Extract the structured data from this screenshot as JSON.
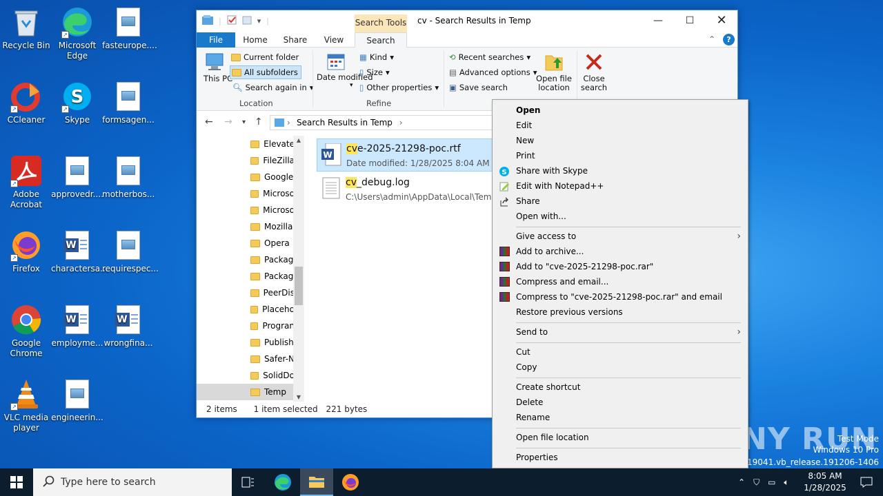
{
  "desktop": {
    "icons": [
      {
        "label": "Recycle Bin",
        "icon": "recycle-bin-icon"
      },
      {
        "label": "CCleaner",
        "icon": "ccleaner-icon"
      },
      {
        "label": "Adobe Acrobat",
        "icon": "acrobat-icon"
      },
      {
        "label": "Firefox",
        "icon": "firefox-icon"
      },
      {
        "label": "Google Chrome",
        "icon": "chrome-icon"
      },
      {
        "label": "VLC media player",
        "icon": "vlc-icon"
      },
      {
        "label": "Microsoft Edge",
        "icon": "edge-icon"
      },
      {
        "label": "Skype",
        "icon": "skype-icon"
      },
      {
        "label": "approvedr....",
        "icon": "image-file-icon"
      },
      {
        "label": "charactersa...",
        "icon": "word-file-icon"
      },
      {
        "label": "employme...",
        "icon": "word-file-icon"
      },
      {
        "label": "engineerin...",
        "icon": "image-file-icon"
      },
      {
        "label": "fasteurope....",
        "icon": "image-file-icon"
      },
      {
        "label": "formsagen...",
        "icon": "image-file-icon"
      },
      {
        "label": "motherbos...",
        "icon": "image-file-icon"
      },
      {
        "label": "requirespec...",
        "icon": "image-file-icon"
      },
      {
        "label": "wrongfina...",
        "icon": "word-file-icon"
      }
    ]
  },
  "explorer": {
    "title": "cv - Search Results in Temp",
    "tools_header": "Search Tools",
    "tabs": [
      "File",
      "Home",
      "Share",
      "View",
      "Search"
    ],
    "ribbon": {
      "this_pc": "This PC",
      "current_folder": "Current folder",
      "all_subfolders": "All subfolders",
      "search_again_in": "Search again in",
      "location_label": "Location",
      "date_modified": "Date modified",
      "kind": "Kind",
      "size": "Size",
      "other_properties": "Other properties",
      "refine_label": "Refine",
      "recent_searches": "Recent searches",
      "advanced_options": "Advanced options",
      "save_search": "Save search",
      "open_file_location": "Open file location",
      "close_search": "Close search"
    },
    "address": "Search Results in Temp",
    "nav_items": [
      "Elevate",
      "FileZilla",
      "Google",
      "Microso",
      "Microso",
      "Mozilla",
      "Opera",
      "Packag",
      "Packag",
      "PeerDis",
      "Placeho",
      "Progran",
      "Publish",
      "Safer-N",
      "SolidDo",
      "Temp"
    ],
    "files": [
      {
        "name_hl": "cv",
        "name_rest": "e-2025-21298-poc.rtf",
        "meta": "Date modified: 1/28/2025 8:04 AM"
      },
      {
        "name_hl": "cv",
        "name_rest": "_debug.log",
        "meta": "C:\\Users\\admin\\AppData\\Local\\Temp"
      }
    ],
    "status": {
      "count": "2 items",
      "selected": "1 item selected",
      "size": "221 bytes"
    }
  },
  "context_menu": {
    "items": [
      {
        "label": "Open",
        "bold": true
      },
      {
        "label": "Edit"
      },
      {
        "label": "New"
      },
      {
        "label": "Print"
      },
      {
        "label": "Share with Skype",
        "icon": "skype"
      },
      {
        "label": "Edit with Notepad++",
        "icon": "notepad"
      },
      {
        "label": "Share",
        "icon": "share"
      },
      {
        "label": "Open with..."
      },
      {
        "label": "Give access to",
        "submenu": true
      },
      {
        "label": "Add to archive...",
        "icon": "rar"
      },
      {
        "label": "Add to \"cve-2025-21298-poc.rar\"",
        "icon": "rar"
      },
      {
        "label": "Compress and email...",
        "icon": "rar"
      },
      {
        "label": "Compress to \"cve-2025-21298-poc.rar\" and email",
        "icon": "rar"
      },
      {
        "label": "Restore previous versions"
      },
      {
        "label": "Send to",
        "submenu": true
      },
      {
        "label": "Cut"
      },
      {
        "label": "Copy"
      },
      {
        "label": "Create shortcut"
      },
      {
        "label": "Delete"
      },
      {
        "label": "Rename"
      },
      {
        "label": "Open file location"
      },
      {
        "label": "Properties"
      }
    ]
  },
  "taskbar": {
    "search_placeholder": "Type here to search",
    "time": "8:05 AM",
    "date": "1/28/2025"
  },
  "watermark": {
    "brand": "ANY RUN",
    "mode": "Test Mode",
    "os": "Windows 10 Pro",
    "build": "Build 19041.vb_release.191206-1406"
  }
}
